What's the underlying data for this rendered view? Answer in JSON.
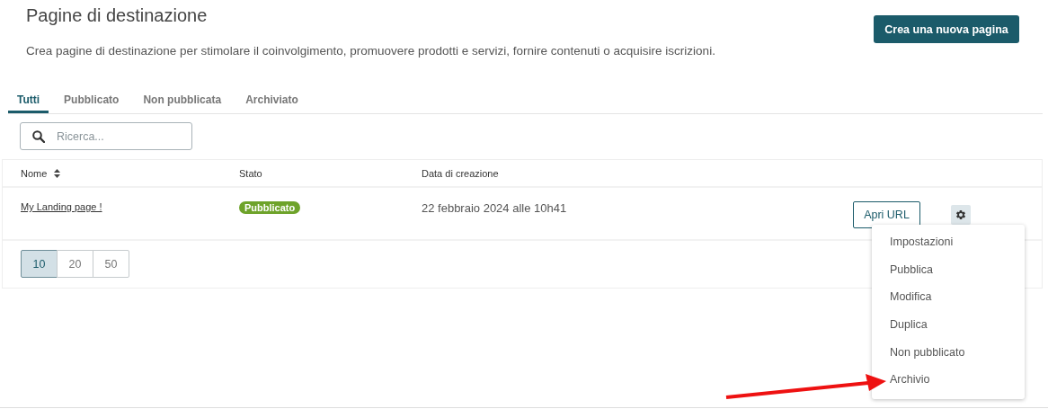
{
  "header": {
    "title": "Pagine di destinazione",
    "description": "Crea pagine di destinazione per stimolare il coinvolgimento, promuovere prodotti e servizi, fornire contenuti o acquisire iscrizioni.",
    "create_button": "Crea una nuova pagina"
  },
  "tabs": [
    {
      "label": "Tutti",
      "selected": true
    },
    {
      "label": "Pubblicato",
      "selected": false
    },
    {
      "label": "Non pubblicata",
      "selected": false
    },
    {
      "label": "Archiviato",
      "selected": false
    }
  ],
  "search": {
    "placeholder": "Ricerca..."
  },
  "table": {
    "columns": [
      {
        "label": "Nome",
        "sortable": true
      },
      {
        "label": "Stato",
        "sortable": false
      },
      {
        "label": "Data di creazione",
        "sortable": false
      }
    ],
    "rows": [
      {
        "name": "My Landing page !",
        "status": "Pubblicato",
        "created": "22 febbraio 2024 alle 10h41",
        "open_button": "Apri URL"
      }
    ]
  },
  "page_sizes": [
    {
      "label": "10",
      "selected": true
    },
    {
      "label": "20",
      "selected": false
    },
    {
      "label": "50",
      "selected": false
    }
  ],
  "menu": {
    "items": [
      "Impostazioni",
      "Pubblica",
      "Modifica",
      "Duplica",
      "Non pubblicato",
      "Archivio"
    ]
  }
}
